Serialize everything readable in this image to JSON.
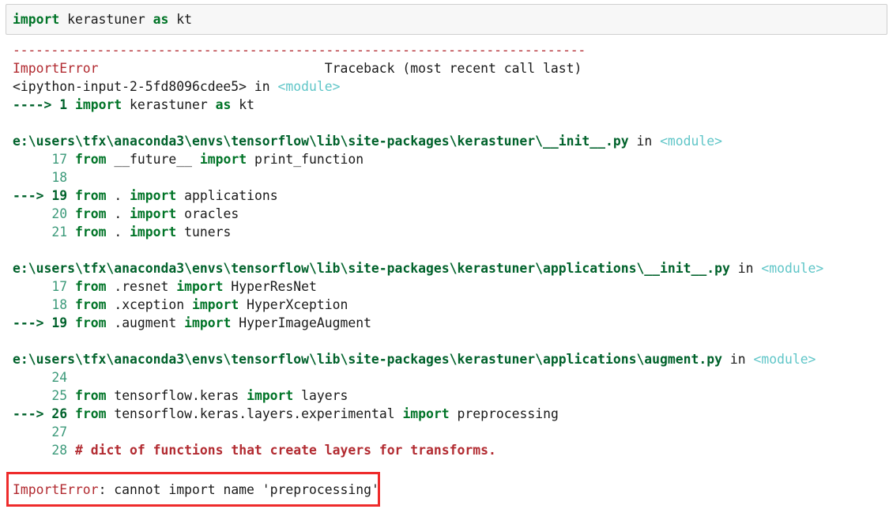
{
  "input_cell": {
    "kw_import": "import",
    "module_name": " kerastuner ",
    "kw_as": "as",
    "alias": " kt"
  },
  "traceback": {
    "dashes": "---------------------------------------------------------------------------",
    "error_type": "ImportError",
    "header_gap": "                             ",
    "header_right": "Traceback (most recent call last)",
    "frames": [
      {
        "location": "<ipython-input-2-5fd8096cdee5>",
        "in_text": " in ",
        "module": "<module>",
        "lines": [
          {
            "arrow": "----> ",
            "lineno": "1",
            "kw1": "import",
            "rest1": " kerastuner ",
            "kw2": "as",
            "rest2": " kt"
          }
        ]
      },
      {
        "location": "e:\\users\\tfx\\anaconda3\\envs\\tensorflow\\lib\\site-packages\\kerastuner\\__init__.py",
        "in_text": " in ",
        "module": "<module>",
        "lines": [
          {
            "prefix": "     ",
            "lineno": "17",
            "kw1": "from",
            "rest1": " __future__ ",
            "kw2": "import",
            "rest2": " print_function"
          },
          {
            "prefix": "     ",
            "lineno": "18"
          },
          {
            "arrow": "---> ",
            "lineno": "19",
            "kw1": "from",
            "rest1": " . ",
            "kw2": "import",
            "rest2": " applications"
          },
          {
            "prefix": "     ",
            "lineno": "20",
            "kw1": "from",
            "rest1": " . ",
            "kw2": "import",
            "rest2": " oracles"
          },
          {
            "prefix": "     ",
            "lineno": "21",
            "kw1": "from",
            "rest1": " . ",
            "kw2": "import",
            "rest2": " tuners"
          }
        ]
      },
      {
        "location": "e:\\users\\tfx\\anaconda3\\envs\\tensorflow\\lib\\site-packages\\kerastuner\\applications\\__init__.py",
        "in_text": " in ",
        "module": "<module>",
        "lines": [
          {
            "prefix": "     ",
            "lineno": "17",
            "kw1": "from",
            "rest1": " .resnet ",
            "kw2": "import",
            "rest2": " HyperResNet"
          },
          {
            "prefix": "     ",
            "lineno": "18",
            "kw1": "from",
            "rest1": " .xception ",
            "kw2": "import",
            "rest2": " HyperXception"
          },
          {
            "arrow": "---> ",
            "lineno": "19",
            "kw1": "from",
            "rest1": " .augment ",
            "kw2": "import",
            "rest2": " HyperImageAugment"
          }
        ]
      },
      {
        "location": "e:\\users\\tfx\\anaconda3\\envs\\tensorflow\\lib\\site-packages\\kerastuner\\applications\\augment.py",
        "in_text": " in ",
        "module": "<module>",
        "lines": [
          {
            "prefix": "     ",
            "lineno": "24"
          },
          {
            "prefix": "     ",
            "lineno": "25",
            "kw1": "from",
            "rest1": " tensorflow.keras ",
            "kw2": "import",
            "rest2": " layers"
          },
          {
            "arrow": "---> ",
            "lineno": "26",
            "kw1": "from",
            "rest1": " tensorflow.keras.layers.experimental ",
            "kw2": "import",
            "rest2": " preprocessing"
          },
          {
            "prefix": "     ",
            "lineno": "27"
          },
          {
            "prefix": "     ",
            "lineno": "28",
            "comment": "# dict of functions that create layers for transforms."
          }
        ]
      }
    ],
    "final_error_type": "ImportError",
    "final_message": ": cannot import name 'preprocessing'"
  },
  "colors": {
    "error_red": "#b22b31",
    "keyword_green": "#007427",
    "module_cyan": "#60c6c8",
    "highlight_border": "#ee2b2b"
  }
}
